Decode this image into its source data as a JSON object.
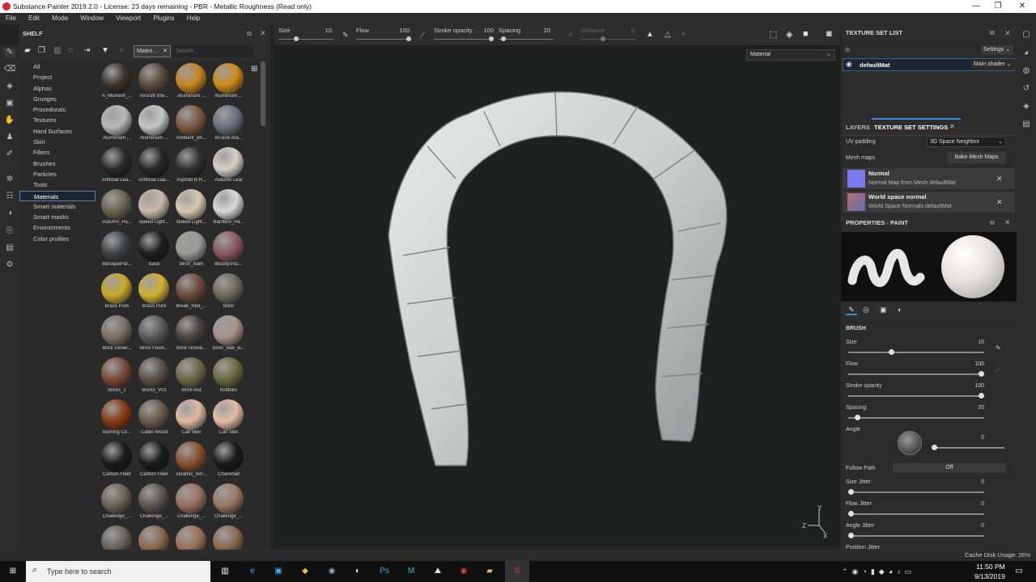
{
  "window": {
    "title": "Substance Painter 2019.2.0 - License: 23 days remaining - PBR - Metallic Roughness (Read only)",
    "controls": [
      "—",
      "❐",
      "✕"
    ]
  },
  "menu": [
    "File",
    "Edit",
    "Mode",
    "Window",
    "Viewport",
    "Plugins",
    "Help"
  ],
  "toolbar": {
    "size": {
      "label": "Size",
      "value": "10"
    },
    "flow": {
      "label": "Flow",
      "value": "100"
    },
    "stroke_opacity": {
      "label": "Stroke opacity",
      "value": "100"
    },
    "spacing": {
      "label": "Spacing",
      "value": "20"
    },
    "distance": {
      "label": "Distance",
      "value": "0"
    }
  },
  "shelf": {
    "title": "SHELF",
    "filter_tag": "Materi...",
    "search_placeholder": "Search...",
    "categories": [
      "All",
      "Project",
      "Alphas",
      "Grunges",
      "Procedurals",
      "Textures",
      "Hard Surfaces",
      "Skin",
      "Filters",
      "Brushes",
      "Particles",
      "Tools",
      "Materials",
      "Smart materials",
      "Smart masks",
      "Environments",
      "Color profiles"
    ],
    "selected_category": "Materials",
    "materials": [
      {
        "name": "A_Moment_...",
        "color": "#3a3128"
      },
      {
        "name": "Aircraft Inte...",
        "color": "#5a4a3a"
      },
      {
        "name": "Aluminium ...",
        "color": "#c8861c"
      },
      {
        "name": "Aluminium ...",
        "color": "#d08a18"
      },
      {
        "name": "Aluminium ...",
        "color": "#b8b8b8"
      },
      {
        "name": "Aluminium ...",
        "color": "#c4c4c4"
      },
      {
        "name": "Ambient_Bri...",
        "color": "#7a5a40"
      },
      {
        "name": "Arcane Ara...",
        "color": "#6a7080"
      },
      {
        "name": "Artificial Lea...",
        "color": "#2a2a2a"
      },
      {
        "name": "Artificial Lea...",
        "color": "#262626"
      },
      {
        "name": "Asphalt B R...",
        "color": "#303030"
      },
      {
        "name": "Autumn Leaf",
        "color": "#d8d0c8"
      },
      {
        "name": "Autumn_Pa...",
        "color": "#6a6450"
      },
      {
        "name": "Baked Light...",
        "color": "#c8b8a8"
      },
      {
        "name": "Baked Light...",
        "color": "#d8c8b0"
      },
      {
        "name": "Bamboo_Pa...",
        "color": "#d8d8d8"
      },
      {
        "name": "BaroquePat...",
        "color": "#404448"
      },
      {
        "name": "base",
        "color": "#1e1e1e"
      },
      {
        "name": "Birch_Bark",
        "color": "#9a9a98"
      },
      {
        "name": "BloodyVisc...",
        "color": "#8a5a60"
      },
      {
        "name": "Brass Pure",
        "color": "#c8a828"
      },
      {
        "name": "Brass Pure",
        "color": "#d0b030"
      },
      {
        "name": "Break_Red_...",
        "color": "#6a4a3a"
      },
      {
        "name": "Brick",
        "color": "#6a6a5a"
      },
      {
        "name": "Brick Gener...",
        "color": "#7a7068"
      },
      {
        "name": "Brick Pavin...",
        "color": "#5a5a5a"
      },
      {
        "name": "Brick Uneve...",
        "color": "#4a4440"
      },
      {
        "name": "Brick_wall_w...",
        "color": "#a89088"
      },
      {
        "name": "bricks_1",
        "color": "#7a4a38"
      },
      {
        "name": "Bricks_V01",
        "color": "#5a5048"
      },
      {
        "name": "BrickTest",
        "color": "#6a6848"
      },
      {
        "name": "bubbles",
        "color": "#6a6a40"
      },
      {
        "name": "Burning Co...",
        "color": "#8a3a14"
      },
      {
        "name": "Cabin Wood",
        "color": "#6a5a4a"
      },
      {
        "name": "Calf Skin",
        "color": "#e0b8a0"
      },
      {
        "name": "Calf Skin",
        "color": "#e4bca4"
      },
      {
        "name": "Carbon Fiber",
        "color": "#1a1a1a"
      },
      {
        "name": "Carbon Fiber",
        "color": "#1c1c1c"
      },
      {
        "name": "ceramic_terr...",
        "color": "#8a5030"
      },
      {
        "name": "Chainmail",
        "color": "#1a1a1a"
      },
      {
        "name": "Challenge_...",
        "color": "#6a6258"
      },
      {
        "name": "Challenge_...",
        "color": "#5a5650"
      },
      {
        "name": "Challenge_...",
        "color": "#9a7060"
      },
      {
        "name": "Challenge_...",
        "color": "#9a7860"
      },
      {
        "name": "",
        "color": "#6a6258"
      },
      {
        "name": "",
        "color": "#8a6a50"
      },
      {
        "name": "",
        "color": "#9a7058"
      },
      {
        "name": "",
        "color": "#8a6a50"
      }
    ]
  },
  "viewport": {
    "mode": "Material"
  },
  "texture_set_list": {
    "title": "TEXTURE SET LIST",
    "settings": "Settings ⌄",
    "item": "defaultMat",
    "shader": "Main shader ⌄"
  },
  "tabs": {
    "layers": "LAYERS",
    "tss": "TEXTURE SET SETTINGS"
  },
  "tss": {
    "uv_padding_label": "UV padding",
    "uv_padding_value": "3D Space Neighbor",
    "mesh_maps_label": "Mesh maps",
    "bake_button": "Bake Mesh Maps",
    "maps": [
      {
        "title": "Normal",
        "sub": "Normal Map from Mesh defaultMat",
        "color": "#7a7af0"
      },
      {
        "title": "World space normal",
        "sub": "World Space Normals defaultMat",
        "color": "#b07070"
      }
    ]
  },
  "properties": {
    "title": "PROPERTIES - PAINT",
    "brush_section": "BRUSH",
    "size": {
      "label": "Size",
      "value": "10",
      "fraction": 0.31
    },
    "flow": {
      "label": "Flow",
      "value": "100",
      "fraction": 1.0
    },
    "stroke_opacity": {
      "label": "Stroke opacity",
      "value": "100",
      "fraction": 1.0
    },
    "spacing": {
      "label": "Spacing",
      "value": "20",
      "fraction": 0.05
    },
    "angle": {
      "label": "Angle",
      "value": "0",
      "fraction": 0.0
    },
    "follow_path": {
      "label": "Follow Path",
      "value": "Off"
    },
    "size_jitter": {
      "label": "Size Jitter",
      "value": "0",
      "fraction": 0.0
    },
    "flow_jitter": {
      "label": "Flow Jitter",
      "value": "0",
      "fraction": 0.0
    },
    "angle_jitter": {
      "label": "Angle Jitter",
      "value": "0",
      "fraction": 0.0
    },
    "position_jitter": {
      "label": "Position Jitter"
    }
  },
  "status": {
    "cache": "Cache Disk Usage:",
    "cache_value": "26%"
  },
  "taskbar": {
    "search_placeholder": "Type here to search",
    "time": "11:50 PM",
    "date": "9/13/2019"
  }
}
